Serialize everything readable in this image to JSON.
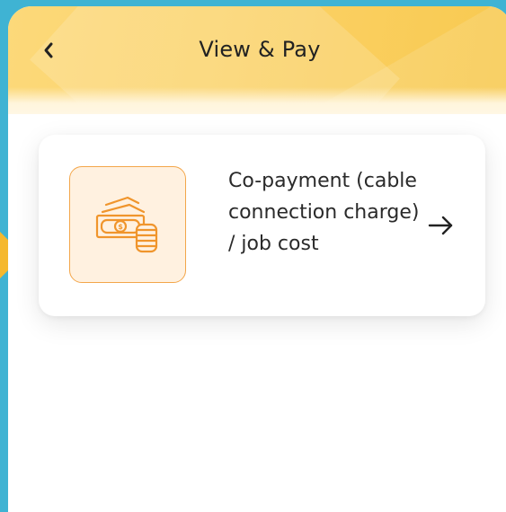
{
  "header": {
    "title": "View & Pay",
    "back_icon": "chevron-left-icon"
  },
  "payment_option": {
    "label": "Co-payment (cable connection charge) / job cost",
    "icon": "cash-coins-icon",
    "arrow_icon": "arrow-right-icon"
  },
  "colors": {
    "header_yellow": "#fbd268",
    "accent_orange": "#f3a64a",
    "icon_tile_bg": "#fff1e0",
    "backdrop_blue": "#3fb3d3"
  }
}
